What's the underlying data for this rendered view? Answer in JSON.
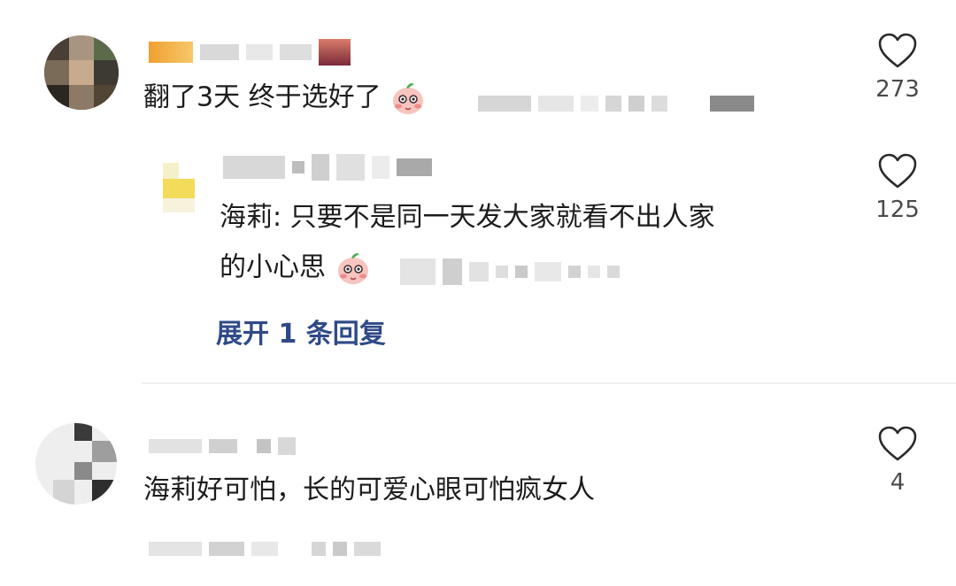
{
  "comments": [
    {
      "text": "翻了3天 终于选好了",
      "likes": "273",
      "reply": {
        "text_line1": "海莉: 只要不是同一天发大家就看不出人家",
        "text_line2": "的小心思",
        "likes": "125"
      },
      "expand_label": "展开 1 条回复"
    },
    {
      "text": "海莉好可怕，长的可爱心眼可怕疯女人",
      "likes": "4"
    }
  ],
  "icons": {
    "like": "heart-outline-icon",
    "emoji": "peach-blush-emoji-icon"
  },
  "colors": {
    "expand_link": "#2f4a87",
    "text": "#1c1c1e",
    "count": "#4a4a4a",
    "divider": "#efefef"
  }
}
